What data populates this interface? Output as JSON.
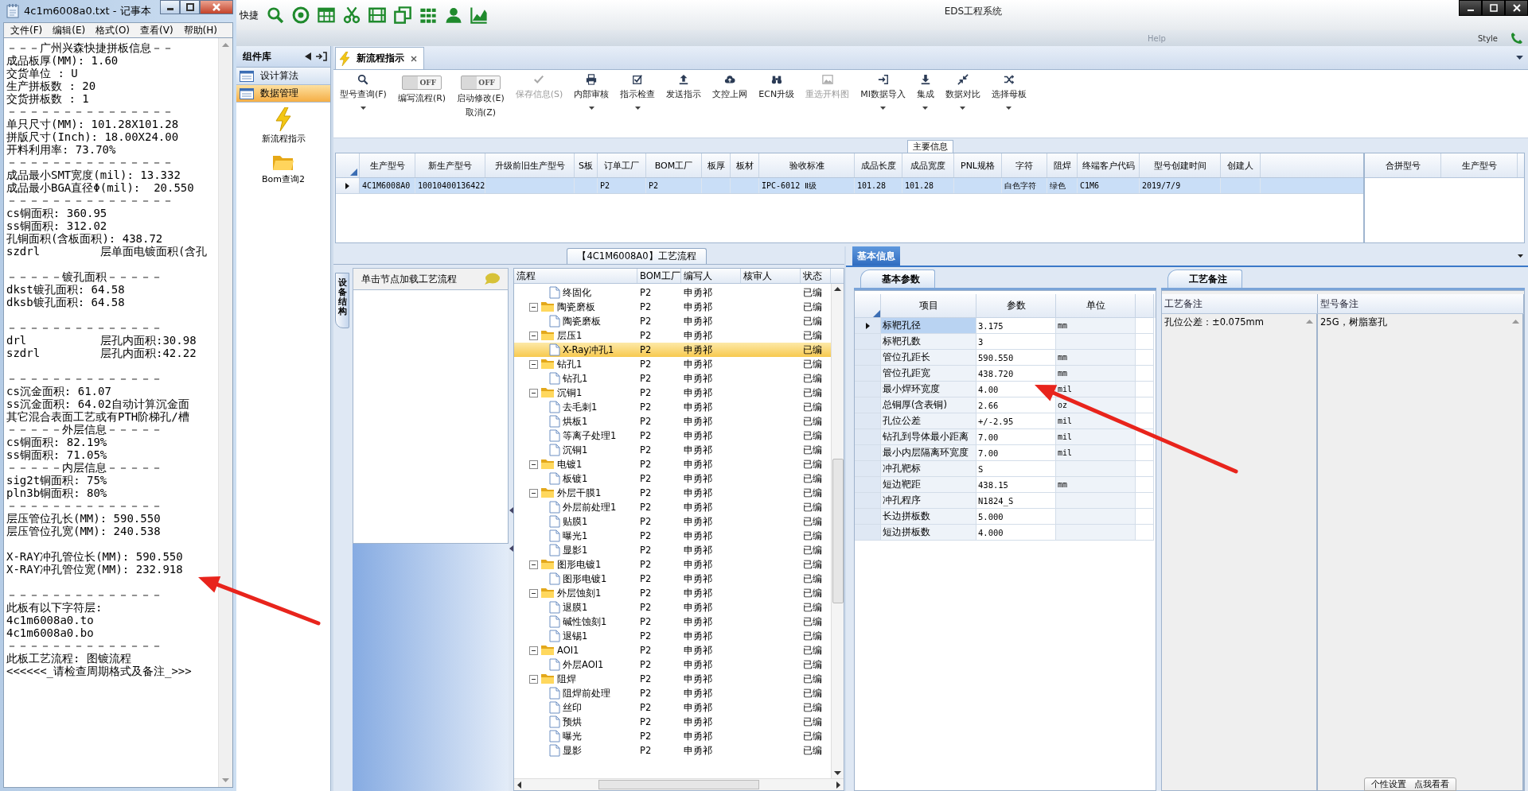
{
  "notepad": {
    "title": "4c1m6008a0.txt - 记事本",
    "menu": [
      "文件(F)",
      "编辑(E)",
      "格式(O)",
      "查看(V)",
      "帮助(H)"
    ],
    "lines": [
      {
        "kind": "text",
        "text": "－－－广州兴森快捷拼板信息－－"
      },
      {
        "kind": "text",
        "text": "成品板厚(MM): 1.60"
      },
      {
        "kind": "text",
        "text": "交货单位 : U"
      },
      {
        "kind": "text",
        "text": "生产拼板数 : 20"
      },
      {
        "kind": "text",
        "text": "交货拼板数 : 1"
      },
      {
        "kind": "text",
        "text": "－－－－－－－－－－－－－－－"
      },
      {
        "kind": "text",
        "text": "单只尺寸(MM): 101.28X101.28"
      },
      {
        "kind": "text",
        "text": "拼版尺寸(Inch): 18.00X24.00"
      },
      {
        "kind": "text",
        "text": "开料利用率: 73.70%"
      },
      {
        "kind": "text",
        "text": "－－－－－－－－－－－－－－－"
      },
      {
        "kind": "text",
        "text": "成品最小SMT宽度(mil): 13.332"
      },
      {
        "kind": "text",
        "text": "成品最小BGA直径Φ(mil):  20.550"
      },
      {
        "kind": "text",
        "text": "－－－－－－－－－－－－－－－"
      },
      {
        "kind": "text",
        "text": "cs铜面积: 360.95"
      },
      {
        "kind": "text",
        "text": "ss铜面积: 312.02"
      },
      {
        "kind": "text",
        "text": "孔铜面积(含板面积): 438.72"
      },
      {
        "kind": "text",
        "text": "szdrl         层单面电镀面积(含孔"
      },
      {
        "kind": "blank"
      },
      {
        "kind": "text",
        "text": "－－－－－镀孔面积－－－－－"
      },
      {
        "kind": "text",
        "text": "dkst镀孔面积: 64.58"
      },
      {
        "kind": "text",
        "text": "dksb镀孔面积: 64.58"
      },
      {
        "kind": "blank"
      },
      {
        "kind": "text",
        "text": "－－－－－－－－－－－－－－"
      },
      {
        "kind": "text",
        "text": "drl           层孔内面积:30.98"
      },
      {
        "kind": "text",
        "text": "szdrl         层孔内面积:42.22"
      },
      {
        "kind": "blank"
      },
      {
        "kind": "text",
        "text": "－－－－－－－－－－－－－－"
      },
      {
        "kind": "text",
        "text": "cs沉金面积: 61.07"
      },
      {
        "kind": "text",
        "text": "ss沉金面积: 64.02自动计算沉金面"
      },
      {
        "kind": "text",
        "text": "其它混合表面工艺或有PTH阶梯孔/槽"
      },
      {
        "kind": "text",
        "text": "－－－－－外层信息－－－－－"
      },
      {
        "kind": "text",
        "text": "cs铜面积: 82.19%"
      },
      {
        "kind": "text",
        "text": "ss铜面积: 71.05%"
      },
      {
        "kind": "text",
        "text": "－－－－－内层信息－－－－－"
      },
      {
        "kind": "text",
        "text": "sig2t铜面积: 75%"
      },
      {
        "kind": "text",
        "text": "pln3b铜面积: 80%"
      },
      {
        "kind": "text",
        "text": "－－－－－－－－－－－－－－"
      },
      {
        "kind": "text",
        "text": "层压管位孔长(MM): 590.550"
      },
      {
        "kind": "text",
        "text": "层压管位孔宽(MM): 240.538"
      },
      {
        "kind": "blank"
      },
      {
        "kind": "text",
        "text": "X-RAY冲孔管位长(MM): 590.550"
      },
      {
        "kind": "text",
        "text": "X-RAY冲孔管位宽(MM): 232.918"
      },
      {
        "kind": "blank"
      },
      {
        "kind": "text",
        "text": "－－－－－－－－－－－－－－"
      },
      {
        "kind": "text",
        "text": "此板有以下字符层:"
      },
      {
        "kind": "text",
        "text": "4c1m6008a0.to"
      },
      {
        "kind": "text",
        "text": "4c1m6008a0.bo"
      },
      {
        "kind": "text",
        "text": "－－－－－－－－－－－－－－"
      },
      {
        "kind": "text",
        "text": "此板工艺流程: 图镀流程"
      },
      {
        "kind": "text",
        "text": "<<<<<<_请检查周期格式及备注_>>>"
      }
    ]
  },
  "app": {
    "quick_label": "快捷",
    "title": "EDS工程系统",
    "background_menu": [
      "Help",
      "Style"
    ]
  },
  "side_panel": {
    "title": "组件库",
    "items": [
      {
        "label": "设计算法",
        "selected": false
      },
      {
        "label": "数据管理",
        "selected": true
      }
    ],
    "tools": [
      {
        "label": "新流程指示",
        "kind": "lightning"
      },
      {
        "label": "Bom查询2",
        "kind": "folder"
      }
    ]
  },
  "doc_tab": {
    "label": "新流程指示",
    "selected": true
  },
  "ribbon": [
    {
      "kind": "button",
      "label": "型号查询(F)",
      "dropdown": true,
      "disabled": false
    },
    {
      "kind": "toggle",
      "label": "编写流程(R)",
      "toggle_text": "OFF",
      "on": false
    },
    {
      "kind": "toggle",
      "label": "启动修改(E)",
      "sublabel": "取消(Z)",
      "toggle_text": "OFF",
      "on": false
    },
    {
      "kind": "button",
      "label": "保存信息(S)",
      "dropdown": false,
      "disabled": true
    },
    {
      "kind": "button",
      "label": "内部审核",
      "dropdown": true,
      "disabled": false
    },
    {
      "kind": "button",
      "label": "指示检查",
      "dropdown": true,
      "disabled": false
    },
    {
      "kind": "button",
      "label": "发送指示",
      "dropdown": false,
      "disabled": false
    },
    {
      "kind": "button",
      "label": "文控上网",
      "dropdown": false,
      "disabled": false
    },
    {
      "kind": "button",
      "label": "ECN升级",
      "dropdown": false,
      "disabled": false
    },
    {
      "kind": "button",
      "label": "重选开料图",
      "dropdown": false,
      "disabled": true
    },
    {
      "kind": "button",
      "label": "MI数据导入",
      "dropdown": true,
      "disabled": false
    },
    {
      "kind": "button",
      "label": "集成",
      "dropdown": true,
      "disabled": false
    },
    {
      "kind": "button",
      "label": "数据对比",
      "dropdown": true,
      "disabled": false
    },
    {
      "kind": "button",
      "label": "选择母板",
      "dropdown": true,
      "disabled": false
    }
  ],
  "main_info": {
    "title": "主要信息",
    "row": {
      "selected": true
    },
    "columns": [
      {
        "label": "生产型号",
        "value": "4C1M6008A0"
      },
      {
        "label": "新生产型号",
        "value": "10010400136422"
      },
      {
        "label": "升级前旧生产型号"
      },
      {
        "label": "S板"
      },
      {
        "label": "订单工厂",
        "value": "P2"
      },
      {
        "label": "BOM工厂",
        "value": "P2"
      },
      {
        "label": "板厚"
      },
      {
        "label": "板材"
      },
      {
        "label": "验收标准",
        "value": "IPC-6012 Ⅱ级"
      },
      {
        "label": "成品长度",
        "value": "101.28"
      },
      {
        "label": "成品宽度",
        "value": "101.28"
      },
      {
        "label": "PNL规格"
      },
      {
        "label": "字符",
        "value": "白色字符"
      },
      {
        "label": "阻焊",
        "value": "绿色"
      },
      {
        "label": "终端客户代码",
        "value": "C1M6"
      },
      {
        "label": "型号创建时间",
        "value": "2019/7/9"
      },
      {
        "label": "创建人"
      }
    ],
    "side_columns": [
      "合拼型号",
      "生产型号"
    ]
  },
  "flow": {
    "title": "【4C1M6008A0】工艺流程",
    "side_tab": "设备结构",
    "hint": "单击节点加载工艺流程",
    "columns": [
      "流程",
      "BOM工厂",
      "编写人",
      "核审人",
      "状态"
    ],
    "nodes": [
      {
        "kind": "leaf",
        "label": "终固化",
        "bom": "P2",
        "writer": "申勇祁",
        "status": "已编",
        "selected": false
      },
      {
        "kind": "folder",
        "label": "陶瓷磨板",
        "bom": "P2",
        "writer": "申勇祁",
        "status": "已编",
        "selected": false,
        "expanded": true,
        "children": [
          {
            "kind": "leaf",
            "label": "陶瓷磨板",
            "bom": "P2",
            "writer": "申勇祁",
            "status": "已编",
            "selected": false
          }
        ]
      },
      {
        "kind": "folder",
        "label": "层压1",
        "bom": "P2",
        "writer": "申勇祁",
        "status": "已编",
        "selected": false,
        "expanded": true,
        "children": [
          {
            "kind": "leaf",
            "label": "X-Ray冲孔1",
            "bom": "P2",
            "writer": "申勇祁",
            "status": "已编",
            "selected": true
          }
        ]
      },
      {
        "kind": "folder",
        "label": "钻孔1",
        "bom": "P2",
        "writer": "申勇祁",
        "status": "已编",
        "selected": false,
        "expanded": true,
        "children": [
          {
            "kind": "leaf",
            "label": "钻孔1",
            "bom": "P2",
            "writer": "申勇祁",
            "status": "已编",
            "selected": false
          }
        ]
      },
      {
        "kind": "folder",
        "label": "沉铜1",
        "bom": "P2",
        "writer": "申勇祁",
        "status": "已编",
        "selected": false,
        "expanded": true,
        "children": [
          {
            "kind": "leaf",
            "label": "去毛刺1",
            "bom": "P2",
            "writer": "申勇祁",
            "status": "已编",
            "selected": false
          },
          {
            "kind": "leaf",
            "label": "烘板1",
            "bom": "P2",
            "writer": "申勇祁",
            "status": "已编",
            "selected": false
          },
          {
            "kind": "leaf",
            "label": "等离子处理1",
            "bom": "P2",
            "writer": "申勇祁",
            "status": "已编",
            "selected": false
          },
          {
            "kind": "leaf",
            "label": "沉铜1",
            "bom": "P2",
            "writer": "申勇祁",
            "status": "已编",
            "selected": false
          }
        ]
      },
      {
        "kind": "folder",
        "label": "电镀1",
        "bom": "P2",
        "writer": "申勇祁",
        "status": "已编",
        "selected": false,
        "expanded": true,
        "children": [
          {
            "kind": "leaf",
            "label": "板镀1",
            "bom": "P2",
            "writer": "申勇祁",
            "status": "已编",
            "selected": false
          }
        ]
      },
      {
        "kind": "folder",
        "label": "外层干膜1",
        "bom": "P2",
        "writer": "申勇祁",
        "status": "已编",
        "selected": false,
        "expanded": true,
        "children": [
          {
            "kind": "leaf",
            "label": "外层前处理1",
            "bom": "P2",
            "writer": "申勇祁",
            "status": "已编",
            "selected": false
          },
          {
            "kind": "leaf",
            "label": "贴膜1",
            "bom": "P2",
            "writer": "申勇祁",
            "status": "已编",
            "selected": false
          },
          {
            "kind": "leaf",
            "label": "曝光1",
            "bom": "P2",
            "writer": "申勇祁",
            "status": "已编",
            "selected": false
          },
          {
            "kind": "leaf",
            "label": "显影1",
            "bom": "P2",
            "writer": "申勇祁",
            "status": "已编",
            "selected": false
          }
        ]
      },
      {
        "kind": "folder",
        "label": "图形电镀1",
        "bom": "P2",
        "writer": "申勇祁",
        "status": "已编",
        "selected": false,
        "expanded": true,
        "children": [
          {
            "kind": "leaf",
            "label": "图形电镀1",
            "bom": "P2",
            "writer": "申勇祁",
            "status": "已编",
            "selected": false
          }
        ]
      },
      {
        "kind": "folder",
        "label": "外层蚀刻1",
        "bom": "P2",
        "writer": "申勇祁",
        "status": "已编",
        "selected": false,
        "expanded": true,
        "children": [
          {
            "kind": "leaf",
            "label": "退膜1",
            "bom": "P2",
            "writer": "申勇祁",
            "status": "已编",
            "selected": false
          },
          {
            "kind": "leaf",
            "label": "碱性蚀刻1",
            "bom": "P2",
            "writer": "申勇祁",
            "status": "已编",
            "selected": false
          },
          {
            "kind": "leaf",
            "label": "退锡1",
            "bom": "P2",
            "writer": "申勇祁",
            "status": "已编",
            "selected": false
          }
        ]
      },
      {
        "kind": "folder",
        "label": "AOI1",
        "bom": "P2",
        "writer": "申勇祁",
        "status": "已编",
        "selected": false,
        "expanded": true,
        "children": [
          {
            "kind": "leaf",
            "label": "外层AOI1",
            "bom": "P2",
            "writer": "申勇祁",
            "status": "已编",
            "selected": false
          }
        ]
      },
      {
        "kind": "folder",
        "label": "阻焊",
        "bom": "P2",
        "writer": "申勇祁",
        "status": "已编",
        "selected": false,
        "expanded": true,
        "children": [
          {
            "kind": "leaf",
            "label": "阻焊前处理",
            "bom": "P2",
            "writer": "申勇祁",
            "status": "已编",
            "selected": false
          },
          {
            "kind": "leaf",
            "label": "丝印",
            "bom": "P2",
            "writer": "申勇祁",
            "status": "已编",
            "selected": false
          },
          {
            "kind": "leaf",
            "label": "预烘",
            "bom": "P2",
            "writer": "申勇祁",
            "status": "已编",
            "selected": false
          },
          {
            "kind": "leaf",
            "label": "曝光",
            "bom": "P2",
            "writer": "申勇祁",
            "status": "已编",
            "selected": false
          },
          {
            "kind": "leaf",
            "label": "显影",
            "bom": "P2",
            "writer": "申勇祁",
            "status": "已编",
            "selected": false
          }
        ]
      }
    ]
  },
  "info": {
    "tab": "基本信息",
    "params_tab": "基本参数",
    "columns": [
      "项目",
      "参数",
      "单位"
    ],
    "rows": [
      {
        "item": "标靶孔径",
        "value": "3.175",
        "unit": "mm",
        "selected": true
      },
      {
        "item": "标靶孔数",
        "value": "3",
        "selected": false
      },
      {
        "item": "管位孔距长",
        "value": "590.550",
        "unit": "mm",
        "selected": false
      },
      {
        "item": "管位孔距宽",
        "value": "438.720",
        "unit": "mm",
        "selected": false
      },
      {
        "item": "最小焊环宽度",
        "value": "4.00",
        "unit": "mil",
        "selected": false
      },
      {
        "item": "总铜厚(含表铜)",
        "value": "2.66",
        "unit": "oz",
        "selected": false
      },
      {
        "item": "孔位公差",
        "value": "+/-2.95",
        "unit": "mil",
        "selected": false
      },
      {
        "item": "钻孔到导体最小距离",
        "value": "7.00",
        "unit": "mil",
        "selected": false
      },
      {
        "item": "最小内层隔离环宽度",
        "value": "7.00",
        "unit": "mil",
        "selected": false
      },
      {
        "item": "冲孔靶标",
        "value": "S",
        "selected": false
      },
      {
        "item": "短边靶距",
        "value": "438.15",
        "unit": "mm",
        "selected": false
      },
      {
        "item": "冲孔程序",
        "value": "N1824_S",
        "selected": false
      },
      {
        "item": "长边拼板数",
        "value": "5.000",
        "selected": false
      },
      {
        "item": "短边拼板数",
        "value": "4.000",
        "selected": false
      }
    ],
    "notes_tab": "工艺备注",
    "notes_columns": [
      {
        "label": "工艺备注",
        "text": "孔位公差：±0.075mm"
      },
      {
        "label": "型号备注",
        "text": "25G，树脂塞孔"
      }
    ]
  },
  "hint_popup": [
    "个性设置",
    "点我看看"
  ]
}
